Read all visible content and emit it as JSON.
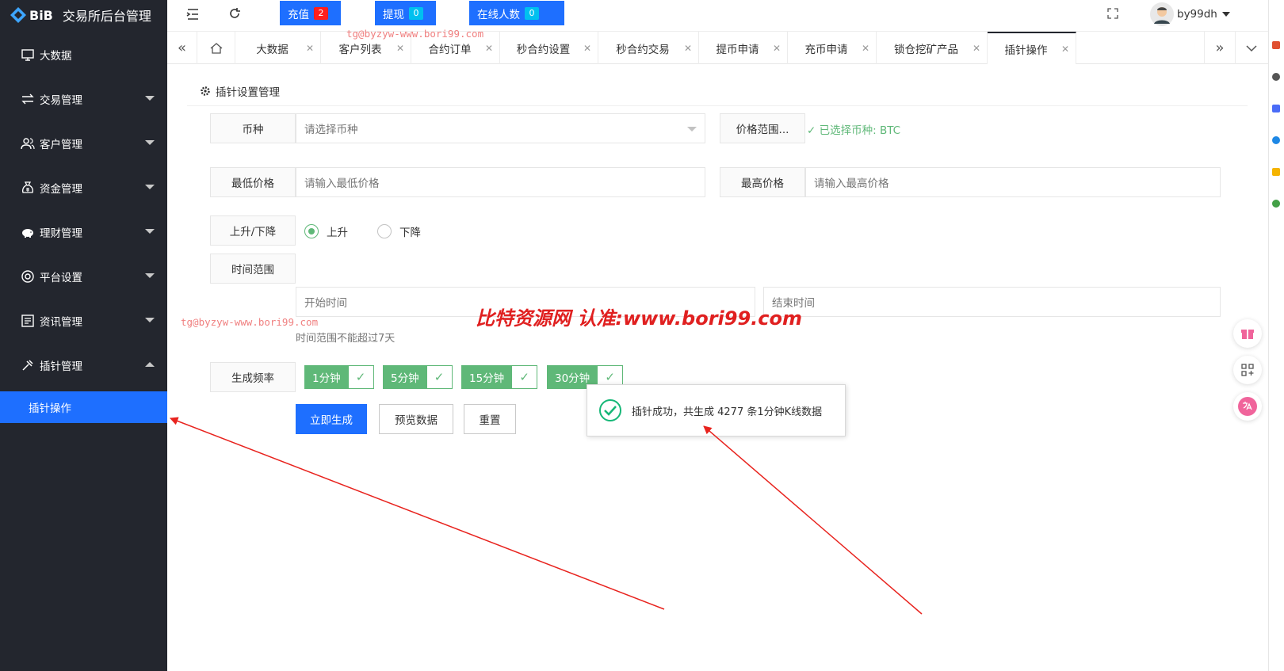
{
  "app": {
    "logo_text": "BiB",
    "title": "交易所后台管理"
  },
  "sidebar": {
    "items": [
      {
        "label": "大数据",
        "icon": "monitor-icon"
      },
      {
        "label": "交易管理",
        "icon": "exchange-icon"
      },
      {
        "label": "客户管理",
        "icon": "users-icon"
      },
      {
        "label": "资金管理",
        "icon": "moneybag-icon"
      },
      {
        "label": "理财管理",
        "icon": "piggybank-icon"
      },
      {
        "label": "平台设置",
        "icon": "settings-circle-icon"
      },
      {
        "label": "资讯管理",
        "icon": "news-icon"
      },
      {
        "label": "插针管理",
        "icon": "pin-icon"
      }
    ],
    "active_sub": "插针操作"
  },
  "header": {
    "recharge": {
      "label": "充值",
      "count": "2",
      "badge_color": "#ff1e1e"
    },
    "withdraw": {
      "label": "提现",
      "count": "0",
      "badge_color": "#00c0ef"
    },
    "online": {
      "label": "在线人数",
      "count": "0",
      "badge_color": "#00c0ef"
    },
    "user": "by99dh"
  },
  "tabs": [
    "大数据",
    "客户列表",
    "合约订单",
    "秒合约设置",
    "秒合约交易",
    "提币申请",
    "充币申请",
    "锁仓挖矿产品",
    "插针操作"
  ],
  "form": {
    "title": "插针设置管理",
    "coin_label": "币种",
    "coin_placeholder": "请选择币种",
    "price_range_label": "价格范围...",
    "selected_hint": "✓ 已选择币种: BTC",
    "min_price_label": "最低价格",
    "min_price_placeholder": "请输入最低价格",
    "max_price_label": "最高价格",
    "max_price_placeholder": "请输入最高价格",
    "direction_label": "上升/下降",
    "up_label": "上升",
    "down_label": "下降",
    "time_range_label": "时间范围",
    "start_placeholder": "开始时间",
    "end_placeholder": "结束时间",
    "time_hint": "时间范围不能超过7天",
    "freq_label": "生成频率",
    "freq_options": [
      "1分钟",
      "5分钟",
      "15分钟",
      "30分钟"
    ],
    "generate_btn": "立即生成",
    "preview_btn": "预览数据",
    "reset_btn": "重置"
  },
  "toast": {
    "message": "插针成功，共生成 4277 条1分钟K线数据"
  },
  "watermarks": {
    "small": "tg@byzyw-www.bori99.com",
    "big": "比特资源网 认准:www.bori99.com"
  },
  "colors": {
    "sidebar": "#23262e",
    "accent": "#1e6fff",
    "green": "#5fb878",
    "arrow": "#e8231e"
  }
}
